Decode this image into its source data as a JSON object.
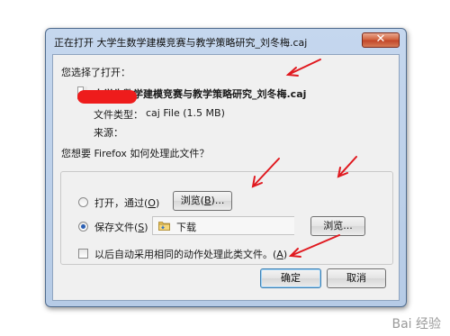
{
  "dialog": {
    "title": "正在打开 大学生数学建模竞赛与教学策略研究_刘冬梅.caj",
    "close_label": "✕"
  },
  "info": {
    "prompt": "您选择了打开：",
    "filename": "大学生数学建模竞赛与教学策略研究_刘冬梅.caj",
    "file_type_label": "文件类型：",
    "file_type_value": "caj File (1.5 MB)",
    "source_label": "来源："
  },
  "action": {
    "question": "您想要 Firefox 如何处理此文件？",
    "open_with_label": "打开，通过(",
    "open_with_key": "O",
    "open_with_close": ")",
    "browse_label_1": "浏览(",
    "browse_key_1": "B",
    "browse_close_1": ")...",
    "save_label": "保存文件(",
    "save_key": "S",
    "save_close": ")",
    "save_folder": "下载",
    "browse_label_2": "浏览...",
    "auto_label": "以后自动采用相同的动作处理此类文件。(",
    "auto_key": "A",
    "auto_close": ")",
    "selected_option": "save"
  },
  "footer": {
    "ok_label": "确定",
    "cancel_label": "取消"
  },
  "watermark": {
    "text": "Bai 经验"
  },
  "colors": {
    "annotation_red": "#e0191f",
    "redaction_red": "#ee1c1c",
    "dialog_frame": "#b6cbe6",
    "close_red": "#c24528"
  }
}
